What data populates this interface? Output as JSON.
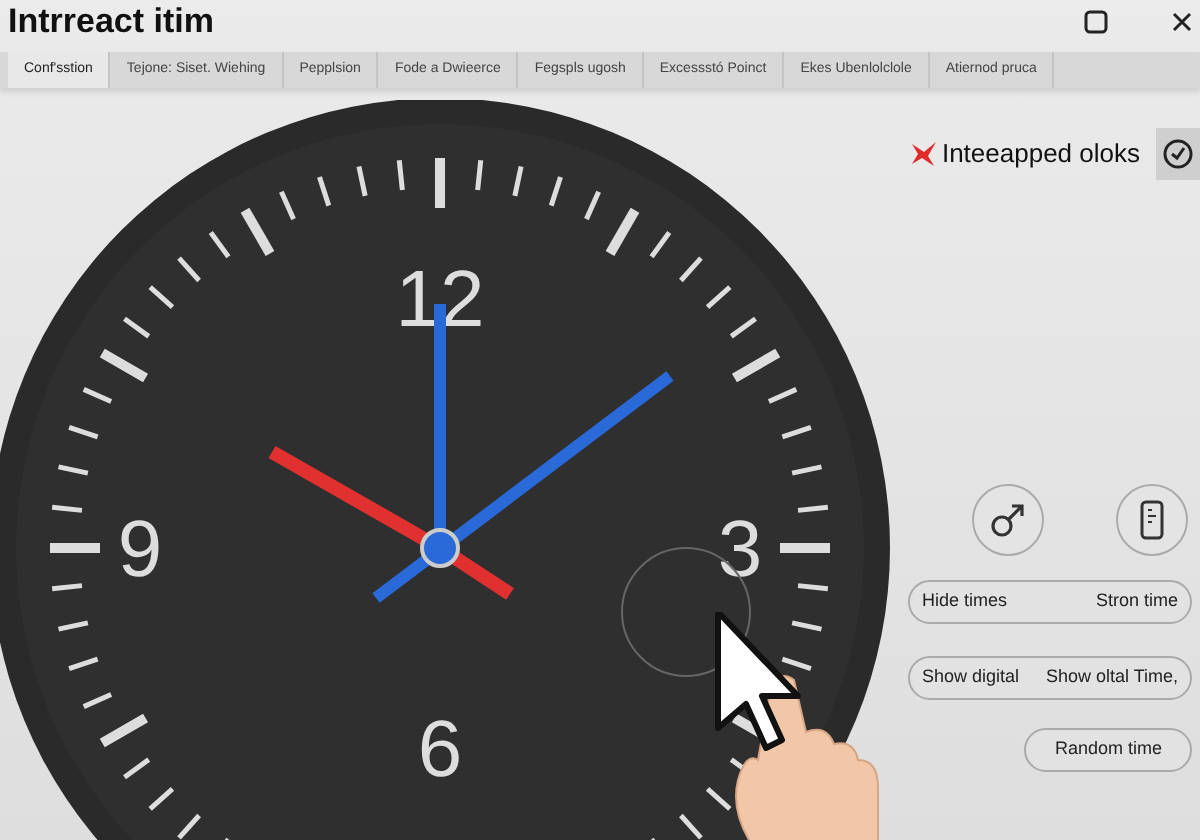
{
  "window": {
    "title": "Intrreact itim"
  },
  "tabs": [
    {
      "label": "Conf'sstion",
      "selected": true
    },
    {
      "label": "Tejone: Siset. Wiehing",
      "selected": false
    },
    {
      "label": "Pepplsion",
      "selected": false
    },
    {
      "label": "Fode a Dwieerce",
      "selected": false
    },
    {
      "label": "Fegspls ugosh",
      "selected": false
    },
    {
      "label": "Excessstó Poinct",
      "selected": false
    },
    {
      "label": "Ekes Ubenlolclole",
      "selected": false
    },
    {
      "label": "Atiernod pruca",
      "selected": false
    }
  ],
  "brand": {
    "label": "Inteeapped oloks"
  },
  "clock": {
    "numerals": [
      "12",
      "3",
      "6",
      "9"
    ]
  },
  "button_rows": [
    [
      "Hide times",
      "Stron time"
    ],
    [
      "Show digital",
      "Show oltal Time,"
    ]
  ],
  "random_button": "Random time"
}
